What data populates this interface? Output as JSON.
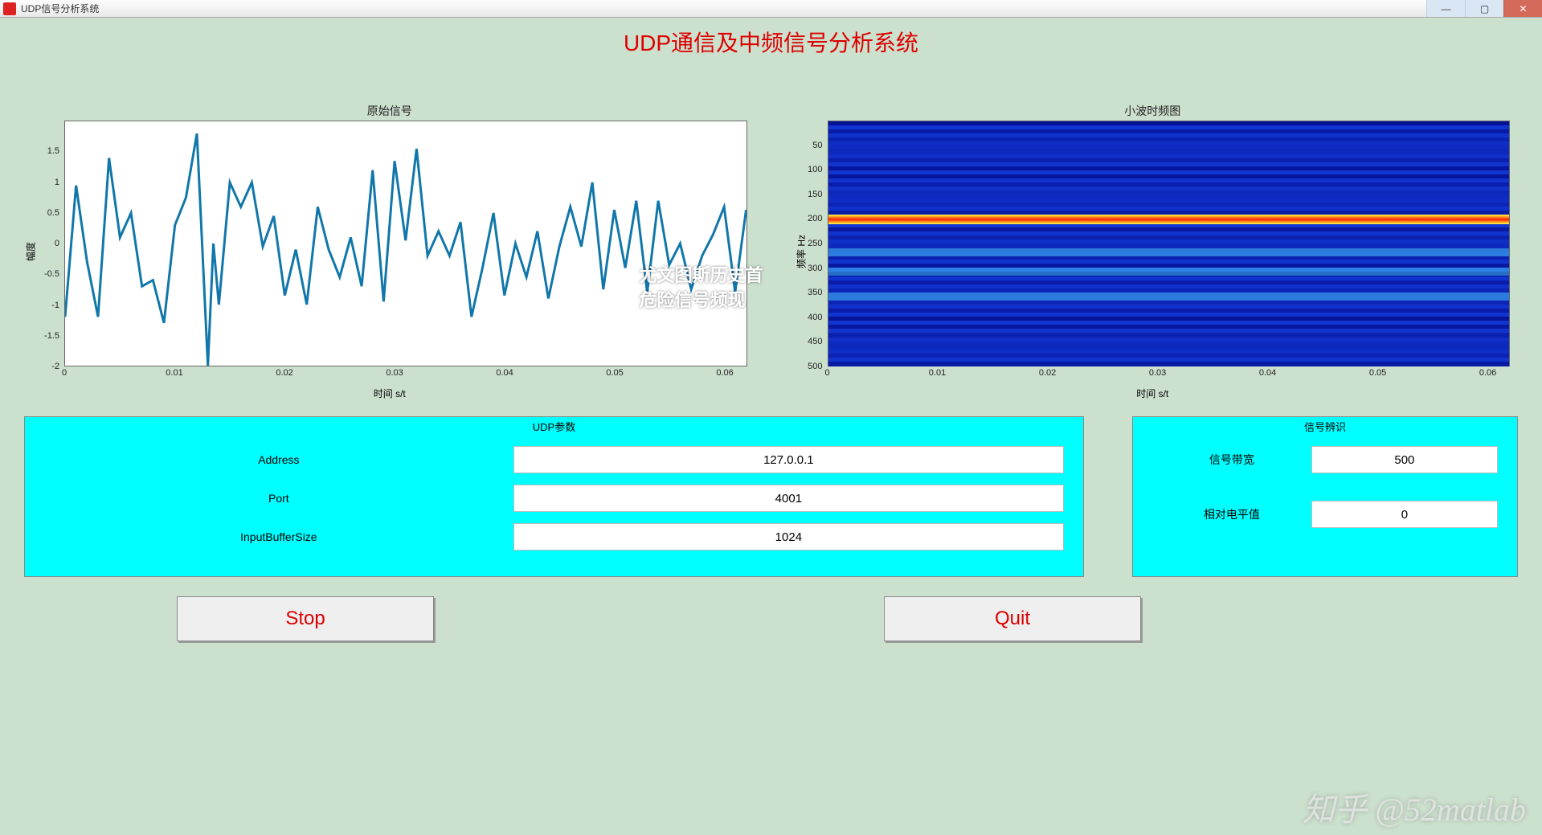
{
  "window": {
    "title": "UDP信号分析系统"
  },
  "main_title": "UDP通信及中频信号分析系统",
  "chart_data": [
    {
      "type": "line",
      "title": "原始信号",
      "xlabel": "时间 s/t",
      "ylabel": "幅度",
      "xlim": [
        0,
        0.062
      ],
      "ylim": [
        -2,
        2
      ],
      "xticks": [
        0,
        0.01,
        0.02,
        0.03,
        0.04,
        0.05,
        0.06
      ],
      "yticks": [
        -2,
        -1.5,
        -1,
        -0.5,
        0,
        0.5,
        1,
        1.5
      ],
      "x": [
        0,
        0.001,
        0.002,
        0.003,
        0.004,
        0.005,
        0.006,
        0.007,
        0.008,
        0.009,
        0.01,
        0.011,
        0.012,
        0.013,
        0.0135,
        0.014,
        0.015,
        0.016,
        0.017,
        0.018,
        0.019,
        0.02,
        0.021,
        0.022,
        0.023,
        0.024,
        0.025,
        0.026,
        0.027,
        0.028,
        0.029,
        0.03,
        0.031,
        0.032,
        0.033,
        0.034,
        0.035,
        0.036,
        0.037,
        0.038,
        0.039,
        0.04,
        0.041,
        0.042,
        0.043,
        0.044,
        0.045,
        0.046,
        0.047,
        0.048,
        0.049,
        0.05,
        0.051,
        0.052,
        0.053,
        0.054,
        0.055,
        0.056,
        0.057,
        0.058,
        0.059,
        0.06,
        0.061,
        0.062
      ],
      "y": [
        -1.2,
        0.95,
        -0.3,
        -1.2,
        1.4,
        0.1,
        0.5,
        -0.7,
        -0.6,
        -1.3,
        0.3,
        0.75,
        1.8,
        -2.0,
        0.0,
        -1.0,
        1.0,
        0.6,
        1.0,
        -0.05,
        0.45,
        -0.85,
        -0.1,
        -1.0,
        0.6,
        -0.1,
        -0.55,
        0.1,
        -0.7,
        1.2,
        -0.95,
        1.35,
        0.05,
        1.55,
        -0.2,
        0.2,
        -0.2,
        0.35,
        -1.2,
        -0.4,
        0.5,
        -0.85,
        0.0,
        -0.55,
        0.2,
        -0.9,
        -0.05,
        0.6,
        -0.05,
        1.0,
        -0.75,
        0.55,
        -0.4,
        0.7,
        -0.8,
        0.7,
        -0.35,
        0.0,
        -0.75,
        -0.2,
        0.15,
        0.6,
        -0.8,
        0.55
      ]
    },
    {
      "type": "heatmap",
      "title": "小波时频图",
      "xlabel": "时间 s/t",
      "ylabel": "频率 Hz",
      "xlim": [
        0,
        0.062
      ],
      "ylim": [
        500,
        0
      ],
      "xticks": [
        0,
        0.01,
        0.02,
        0.03,
        0.04,
        0.05,
        0.06
      ],
      "yticks": [
        50,
        100,
        150,
        200,
        250,
        300,
        350,
        400,
        450,
        500
      ],
      "dominant_frequency_hz": 200
    }
  ],
  "overlay": {
    "line1": "尤文图斯历史首",
    "line2": "危险信号频现"
  },
  "panels": {
    "udp": {
      "title": "UDP参数",
      "rows": [
        {
          "label": "Address",
          "value": "127.0.0.1"
        },
        {
          "label": "Port",
          "value": "4001"
        },
        {
          "label": "InputBufferSize",
          "value": "1024"
        }
      ]
    },
    "signal": {
      "title": "信号辨识",
      "rows": [
        {
          "label": "信号带宽",
          "value": "500"
        },
        {
          "label": "相对电平值",
          "value": "0"
        }
      ]
    }
  },
  "buttons": {
    "stop": "Stop",
    "quit": "Quit"
  },
  "watermark": "知乎 @52matlab"
}
